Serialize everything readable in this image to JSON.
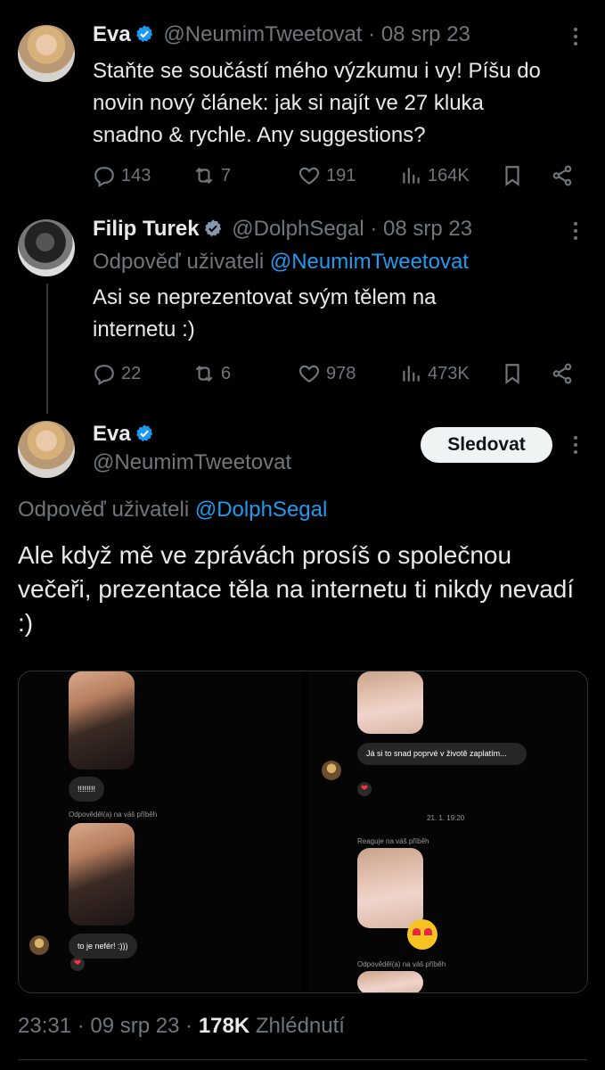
{
  "tweet1": {
    "name": "Eva",
    "handle": "@NeumimTweetovat",
    "sep": "·",
    "date": "08 srp 23",
    "text": "Staňte se součástí mého výzkumu i vy! Píšu do novin nový článek: jak si najít ve 27 kluka snadno & rychle. Any suggestions?",
    "replies": "143",
    "retweets": "7",
    "likes": "191",
    "views": "164K"
  },
  "tweet2": {
    "name": "Filip Turek",
    "handle": "@DolphSegal",
    "sep": "·",
    "date": "08 srp 23",
    "reply_prefix": "Odpověď uživateli",
    "reply_handle": "@NeumimTweetovat",
    "text": "Asi se neprezentovat svým tělem na internetu :)",
    "replies": "22",
    "retweets": "6",
    "likes": "978",
    "views": "473K"
  },
  "tweet3": {
    "name": "Eva",
    "handle": "@NeumimTweetovat",
    "follow_label": "Sledovat",
    "reply_prefix": "Odpověď uživateli",
    "reply_handle": "@DolphSegal",
    "text": "Ale když mě ve zprávách prosíš o společnou večeři, prezentace těla na internetu ti nikdy nevadí :)",
    "media": {
      "left": {
        "bubble1": "!!!!!!!!",
        "story_note1": "Odpověděl(a) na váš příběh",
        "bubble2": "to je nefér! :)))"
      },
      "right": {
        "bubble1": "Já si to snad poprvé v životě zaplatím...",
        "timestamp": "21. 1. 19:20",
        "story_note1": "Reaguje na váš příběh",
        "story_note2": "Odpověděl(a) na váš příběh"
      }
    },
    "time": "23:31",
    "sep": "·",
    "date": "09 srp 23",
    "sep2": "·",
    "views_count": "178K",
    "views_label": "Zhlédnutí"
  },
  "colors": {
    "background": "#000000",
    "text": "#e7e9ea",
    "muted": "#71767b",
    "link": "#1d9bf0",
    "verified": "#1d9bf0",
    "verified_gray": "#829aab"
  }
}
